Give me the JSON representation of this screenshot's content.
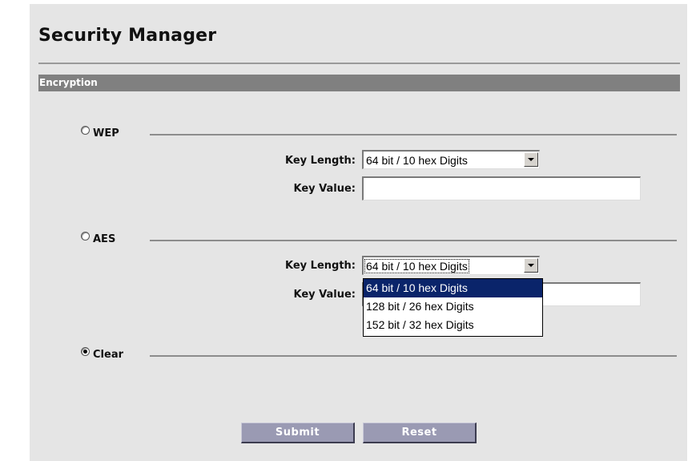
{
  "page": {
    "title": "Security Manager"
  },
  "section": {
    "label": "Encryption"
  },
  "groups": {
    "wep": {
      "label": "WEP",
      "selected": false,
      "key_length_label": "Key Length:",
      "key_length_value": "64 bit / 10 hex Digits",
      "key_value_label": "Key Value:",
      "key_value": ""
    },
    "aes": {
      "label": "AES",
      "selected": false,
      "key_length_label": "Key Length:",
      "key_length_value": "64 bit / 10 hex Digits",
      "key_value_label": "Key Value:",
      "key_value": "",
      "dropdown_open": true,
      "options": [
        "64 bit / 10 hex Digits",
        "128 bit / 26 hex Digits",
        "152 bit / 32 hex Digits"
      ],
      "highlighted_option": 0
    },
    "clear": {
      "label": "Clear",
      "selected": true
    }
  },
  "buttons": {
    "submit": "Submit",
    "reset": "Reset"
  },
  "colors": {
    "panel_bg": "#e5e5e5",
    "section_bar": "#808080",
    "button_bg": "#9a9ab3",
    "selection_highlight": "#0a246a"
  }
}
